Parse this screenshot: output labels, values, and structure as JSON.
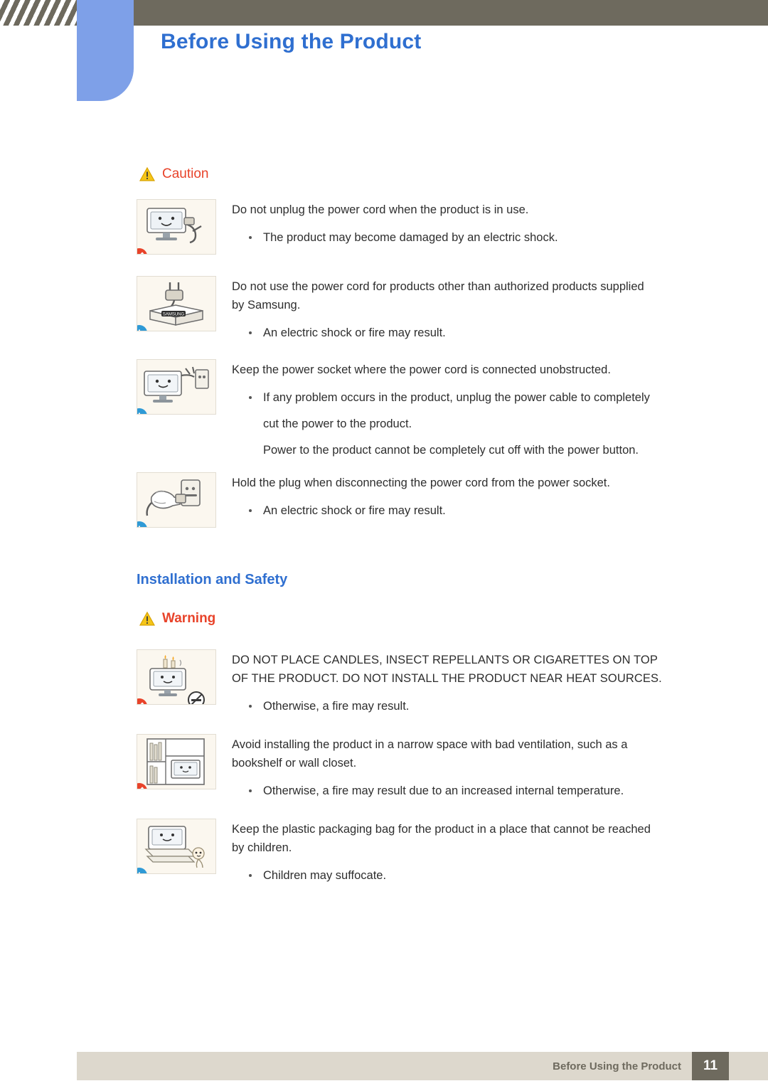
{
  "header": {
    "title": "Before Using the Product"
  },
  "caution_section": {
    "label": "Caution",
    "icon": "warning-triangle-icon",
    "items": [
      {
        "art": "monitor-unplug-icon",
        "badge": "prohibit",
        "lines": [
          "Do not unplug the power cord when the product is in use."
        ],
        "bullets": [
          "The product may become damaged by an electric shock."
        ],
        "plain": []
      },
      {
        "art": "power-plug-box-icon",
        "badge": "info",
        "lines": [
          "Do not use the power cord for products other than authorized products supplied",
          "by Samsung."
        ],
        "bullets": [
          "An electric shock or fire may result."
        ],
        "plain": []
      },
      {
        "art": "monitor-socket-icon",
        "badge": "info",
        "lines": [
          "Keep the power socket where the power cord is connected unobstructed."
        ],
        "bullets": [
          "If any problem occurs in the product, unplug the power cable to completely",
          "cut the power to the product."
        ],
        "plain": [
          "Power to the product cannot be completely cut off with the power button."
        ]
      },
      {
        "art": "hand-holding-plug-icon",
        "badge": "info",
        "lines": [
          "Hold the plug when disconnecting the power cord from the power socket."
        ],
        "bullets": [
          "An electric shock or fire may result."
        ],
        "plain": []
      }
    ]
  },
  "installation_section": {
    "heading": "Installation and Safety",
    "label": "Warning",
    "icon": "warning-triangle-icon",
    "items": [
      {
        "art": "candles-on-monitor-icon",
        "badge": "prohibit",
        "lines": [
          "DO NOT PLACE CANDLES, INSECT REPELLANTS OR CIGARETTES ON TOP",
          "OF THE PRODUCT. DO NOT INSTALL THE PRODUCT NEAR HEAT SOURCES."
        ],
        "bullets": [
          "Otherwise, a fire may result."
        ],
        "plain": []
      },
      {
        "art": "monitor-in-bookshelf-icon",
        "badge": "prohibit",
        "lines": [
          "Avoid installing the product in a narrow space with bad ventilation, such as a",
          "bookshelf or wall closet."
        ],
        "bullets": [
          "Otherwise, a fire may result due to an increased internal temperature."
        ],
        "plain": []
      },
      {
        "art": "plastic-bag-child-icon",
        "badge": "info",
        "lines": [
          "Keep the plastic packaging bag for the product in a place that cannot be reached",
          "by children."
        ],
        "bullets": [
          "Children may suffocate."
        ],
        "plain": []
      }
    ]
  },
  "footer": {
    "text": "Before Using the Product",
    "page": "11"
  },
  "colors": {
    "header_band": "#6e6a5e",
    "accent_blue": "#2f6fd0",
    "alert_red": "#e8432a",
    "info_blue": "#2f9ad6",
    "footer_band": "#ddd8cd",
    "illus_bg": "#fbf7ef"
  }
}
